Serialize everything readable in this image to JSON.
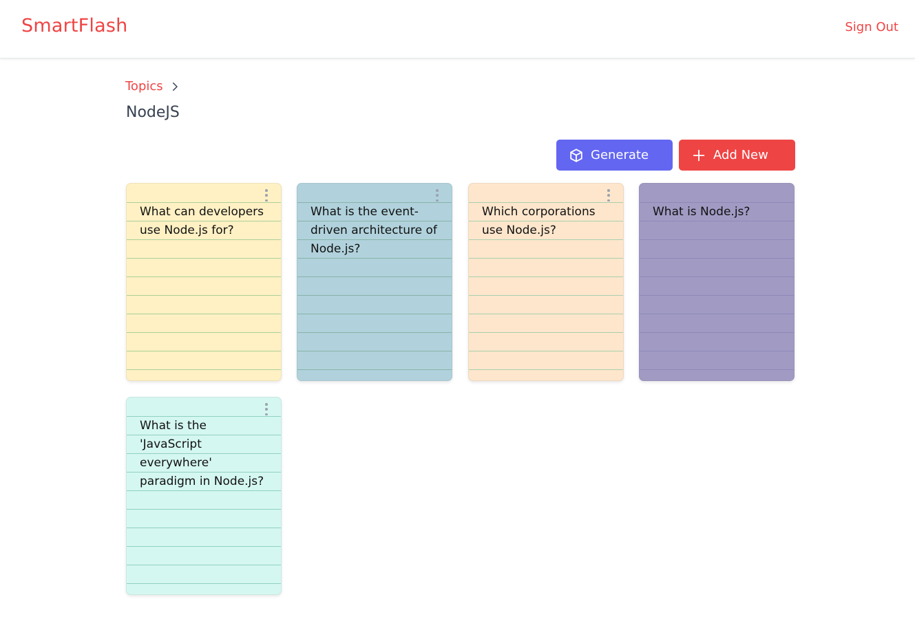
{
  "app": {
    "brand": "SmartFlash",
    "sign_out": "Sign Out"
  },
  "breadcrumb": {
    "topics": "Topics"
  },
  "page": {
    "title": "NodeJS"
  },
  "actions": {
    "generate": "Generate",
    "add_new": "Add New"
  },
  "colors": {
    "accent_red": "#ef4444",
    "accent_indigo": "#6366f1"
  },
  "cards": [
    {
      "text": "What can developers use Node.js for?",
      "bg": "#fff1c4",
      "line": "#a9cf9a",
      "has_menu": true
    },
    {
      "text": "What is the event-driven architecture of Node.js?",
      "bg": "#b1d2dc",
      "line": "#86b2a8",
      "has_menu": true
    },
    {
      "text": "Which corporations use Node.js?",
      "bg": "#fde6cc",
      "line": "#a9cfae",
      "has_menu": true
    },
    {
      "text": "What is Node.js?",
      "bg": "#a19bc4",
      "line": "#8c88b8",
      "has_menu": false
    },
    {
      "text": "What is the 'JavaScript everywhere' paradigm in Node.js?",
      "bg": "#d5f7f1",
      "line": "#8fd0c0",
      "has_menu": true
    }
  ]
}
